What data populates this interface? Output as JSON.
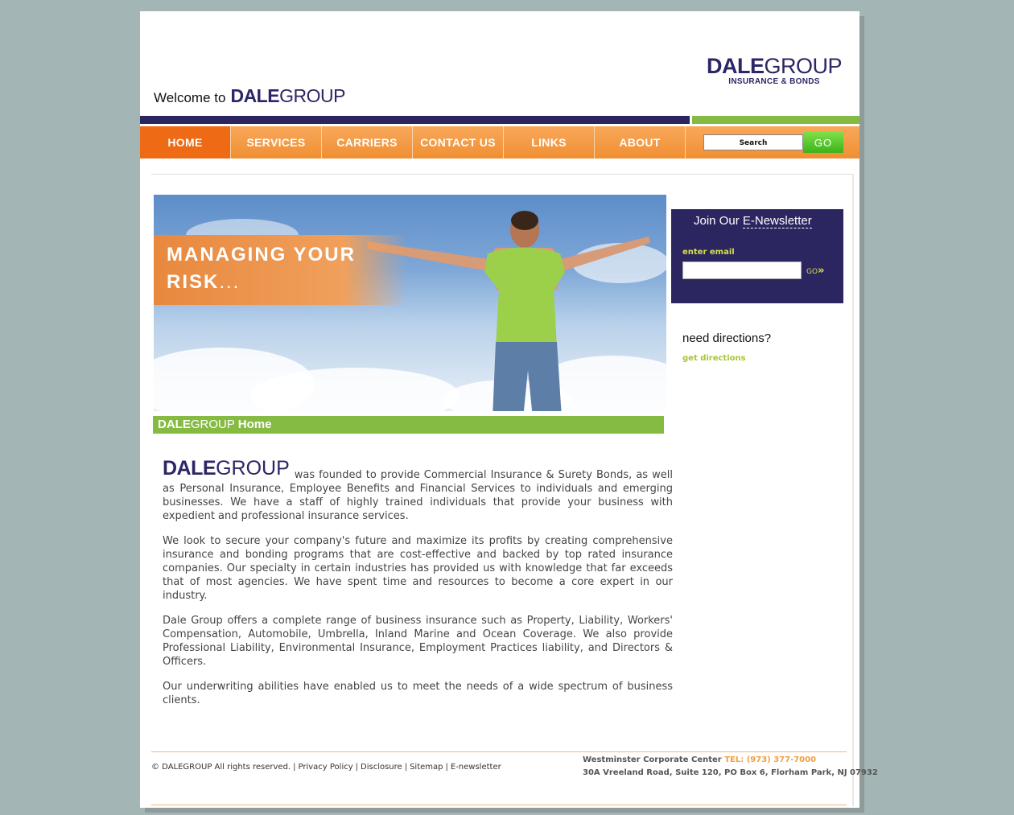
{
  "brand": {
    "bold": "DALE",
    "light": "GROUP",
    "tagline": "INSURANCE & BONDS"
  },
  "welcome": {
    "prefix": "Welcome to"
  },
  "nav": {
    "items": [
      "HOME",
      "SERVICES",
      "CARRIERS",
      "CONTACT US",
      "LINKS",
      "ABOUT"
    ],
    "active": "HOME"
  },
  "search": {
    "placeholder": "Search",
    "button": "GO"
  },
  "hero": {
    "line1": "MANAGING YOUR",
    "line2": "RISK",
    "ellipsis": "..."
  },
  "section_title": {
    "brand_bold": "DALE",
    "brand_light": "GROUP",
    "suffix": "Home"
  },
  "newsletter": {
    "title_prefix": "Join Our",
    "title_link": "E-Newsletter",
    "label": "enter email",
    "go": "GO",
    "go_icon": "»"
  },
  "directions": {
    "heading": "need directions?",
    "link": "get directions"
  },
  "content": {
    "p1": "was founded to provide Commercial Insurance & Surety Bonds, as well as Personal Insurance, Employee Benefits and Financial Services to individuals and emerging businesses. We have a staff of highly trained individuals that provide your business with expedient and professional insurance services.",
    "p2": "We look to secure your company's future and maximize its profits by creating comprehensive insurance and bonding programs that are cost-effective and backed by top rated insurance companies. Our specialty in certain industries has provided us with knowledge that far exceeds that of most agencies. We have spent time and resources to become a core expert in our industry.",
    "p3": "Dale Group offers a complete range of business insurance such as Property, Liability, Workers' Compensation, Automobile, Umbrella, Inland Marine and Ocean Coverage. We also provide Professional Liability, Environmental Insurance, Employment Practices liability, and Directors & Officers.",
    "p4": "Our underwriting abilities have enabled us to meet the needs of a wide spectrum of business clients."
  },
  "footer": {
    "copyright": "© DALEGROUP All rights reserved.",
    "links": [
      "Privacy Policy",
      "Disclosure",
      "Sitemap",
      "E-newsletter"
    ],
    "office": "Westminster Corporate Center",
    "tel": "TEL: (973) 377-7000",
    "address": "30A Vreeland Road, Suite 120, PO Box 6, Florham Park, NJ 07932"
  },
  "colors": {
    "navy": "#2b2560",
    "orange": "#f08f33",
    "active_orange": "#ee6a14",
    "green": "#86bb43",
    "lime": "#a6c43a",
    "background": "#a3b5b4"
  }
}
